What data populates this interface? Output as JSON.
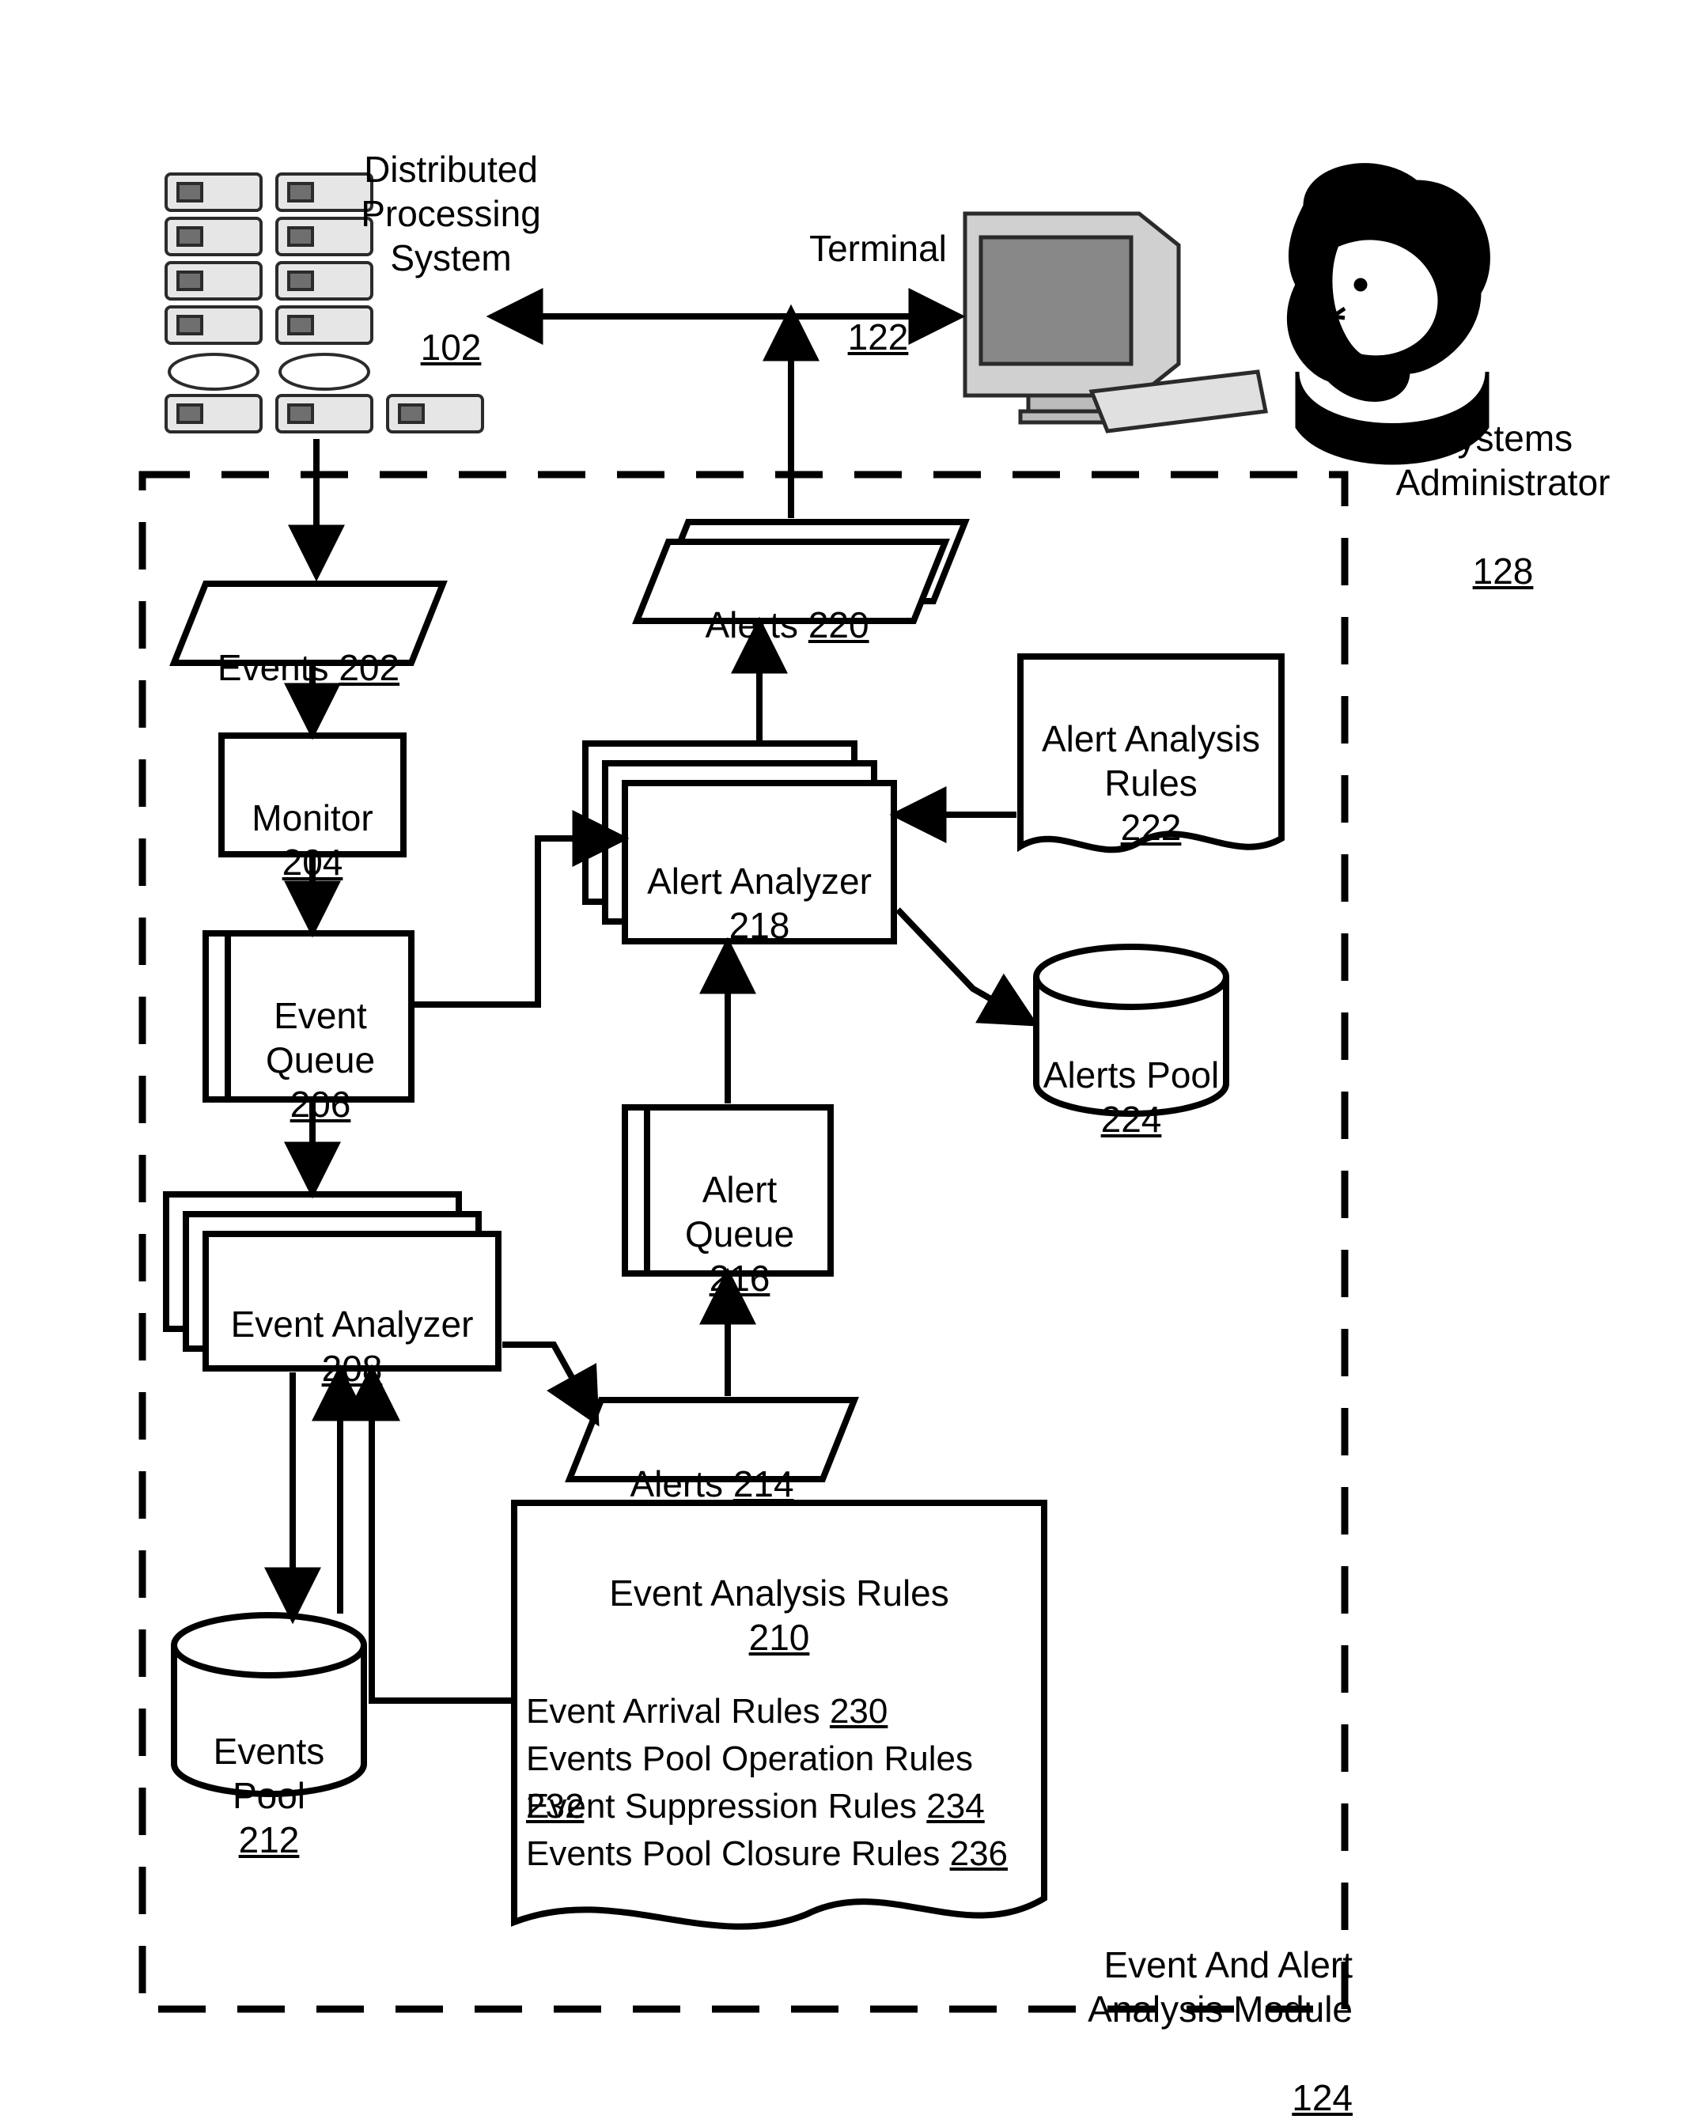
{
  "title_dps": {
    "text": "Distributed Processing\nSystem",
    "ref": "102"
  },
  "title_terminal": {
    "text": "Terminal",
    "ref": "122"
  },
  "title_sysadmin": {
    "text": "Systems\nAdministrator",
    "ref": "128"
  },
  "module_label": {
    "text": "Event And Alert\nAnalysis Module",
    "ref": "124"
  },
  "events": {
    "text": "Events",
    "ref": "202"
  },
  "monitor": {
    "text": "Monitor",
    "ref": "204"
  },
  "event_queue": {
    "text": "Event\nQueue",
    "ref": "206"
  },
  "event_analyzer": {
    "text": "Event Analyzer",
    "ref": "208"
  },
  "events_pool": {
    "text": "Events Pool",
    "ref": "212"
  },
  "event_rules": {
    "title": "Event Analysis Rules",
    "ref": "210",
    "rows": [
      {
        "label": "Event Arrival Rules",
        "ref": "230"
      },
      {
        "label": "Events Pool Operation Rules",
        "ref": "232"
      },
      {
        "label": "Event Suppression Rules",
        "ref": "234"
      },
      {
        "label": "Events Pool Closure Rules",
        "ref": "236"
      }
    ]
  },
  "alerts_step": {
    "text": "Alerts",
    "ref": "214"
  },
  "alert_queue": {
    "text": "Alert\nQueue",
    "ref": "216"
  },
  "alert_analyzer": {
    "text": "Alert Analyzer",
    "ref": "218"
  },
  "alerts_out": {
    "text": "Alerts",
    "ref": "220"
  },
  "alert_rules": {
    "text": "Alert Analysis\nRules",
    "ref": "222"
  },
  "alerts_pool": {
    "text": "Alerts Pool",
    "ref": "224"
  }
}
